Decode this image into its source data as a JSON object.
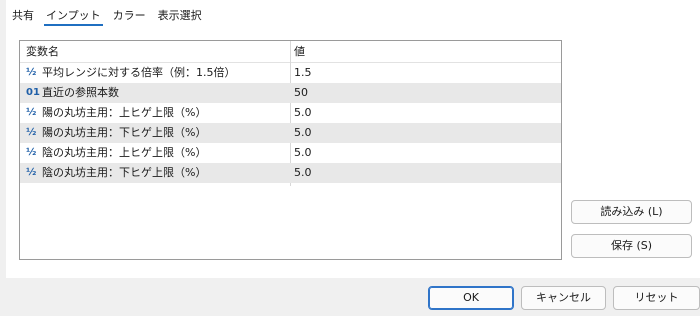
{
  "tabs": [
    {
      "label": "共有"
    },
    {
      "label": "インプット"
    },
    {
      "label": "カラー"
    },
    {
      "label": "表示選択"
    }
  ],
  "grid": {
    "header": {
      "name": "変数名",
      "value": "値"
    },
    "rows": [
      {
        "icon": "½",
        "icon_name": "fraction-icon",
        "name": "平均レンジに対する倍率（例：1.5倍）",
        "value": "1.5"
      },
      {
        "icon": "01",
        "icon_name": "integer-icon",
        "name": "直近の参照本数",
        "value": "50"
      },
      {
        "icon": "½",
        "icon_name": "fraction-icon",
        "name": "陽の丸坊主用：上ヒゲ上限（%）",
        "value": "5.0"
      },
      {
        "icon": "½",
        "icon_name": "fraction-icon",
        "name": "陽の丸坊主用：下ヒゲ上限（%）",
        "value": "5.0"
      },
      {
        "icon": "½",
        "icon_name": "fraction-icon",
        "name": "陰の丸坊主用：上ヒゲ上限（%）",
        "value": "5.0"
      },
      {
        "icon": "½",
        "icon_name": "fraction-icon",
        "name": "陰の丸坊主用：下ヒゲ上限（%）",
        "value": "5.0"
      }
    ]
  },
  "side_buttons": {
    "load": "読み込み (L)",
    "save": "保存 (S)"
  },
  "footer_buttons": {
    "ok": "OK",
    "cancel": "キャンセル",
    "reset": "リセット"
  },
  "colors": {
    "accent": "#1f6fc1",
    "int_icon": "#1f5fa8"
  }
}
